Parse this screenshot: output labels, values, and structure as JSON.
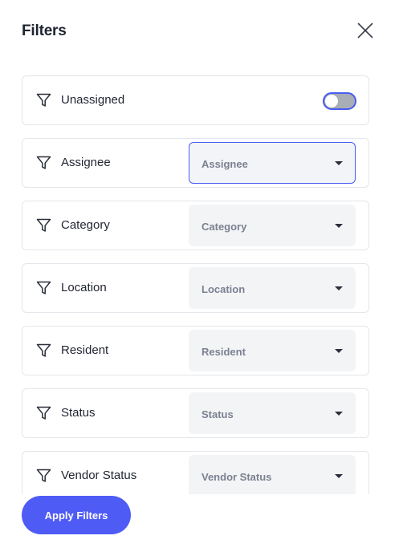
{
  "header": {
    "title": "Filters"
  },
  "filters": {
    "unassigned": {
      "label": "Unassigned",
      "toggle_on": false
    },
    "assignee": {
      "label": "Assignee",
      "placeholder": "Assignee"
    },
    "category": {
      "label": "Category",
      "placeholder": "Category"
    },
    "location": {
      "label": "Location",
      "placeholder": "Location"
    },
    "resident": {
      "label": "Resident",
      "placeholder": "Resident"
    },
    "status": {
      "label": "Status",
      "placeholder": "Status"
    },
    "vendor_status": {
      "label": "Vendor Status",
      "placeholder": "Vendor Status"
    }
  },
  "footer": {
    "apply_label": "Apply Filters"
  },
  "colors": {
    "accent": "#4f5bf5",
    "toggle_track": "#a9adb5",
    "select_bg": "#f3f4f6",
    "border": "#e3e6eb"
  },
  "icons": {
    "close": "close-icon",
    "filter": "filter-funnel-icon",
    "dropdown": "caret-down-icon"
  }
}
